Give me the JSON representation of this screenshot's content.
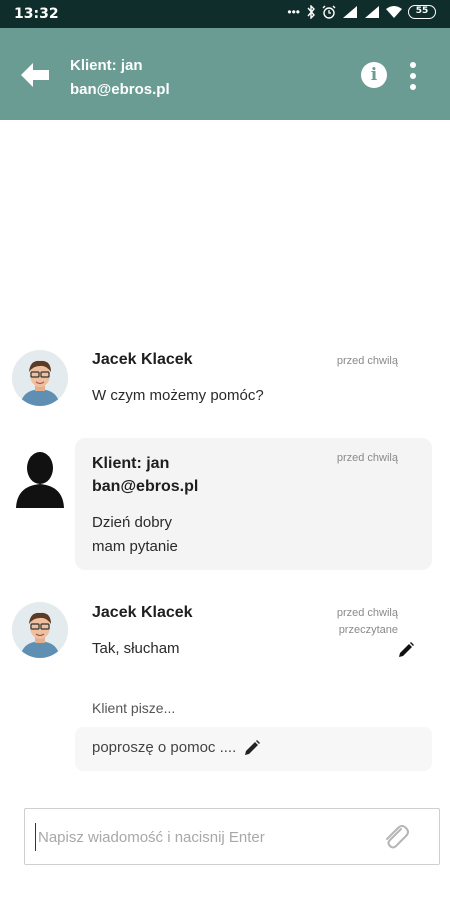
{
  "status_bar": {
    "time": "13:32",
    "battery": "55",
    "icons": [
      "dots-icon",
      "bluetooth-icon",
      "alarm-icon",
      "signal-icon",
      "signal-icon",
      "wifi-icon",
      "battery-icon"
    ]
  },
  "header": {
    "title_line1": "Klient: jan",
    "title_line2": "ban@ebros.pl",
    "bg_color": "#6a9c94"
  },
  "messages": [
    {
      "sender": "Jacek Klacek",
      "time": "przed chwilą",
      "lines": [
        "W czym możemy pomóc?"
      ],
      "avatar": "agent-avatar"
    },
    {
      "sender": "Klient: jan",
      "sender_line2": "ban@ebros.pl",
      "time": "przed chwilą",
      "lines": [
        "Dzień dobry",
        "mam pytanie"
      ],
      "avatar": "user-silhouette-icon"
    },
    {
      "sender": "Jacek Klacek",
      "time": "przed chwilą",
      "status": "przeczytane",
      "lines": [
        "Tak, słucham"
      ],
      "avatar": "agent-avatar"
    }
  ],
  "typing": {
    "label": "Klient pisze...",
    "draft": "poproszę o pomoc ...."
  },
  "composer": {
    "placeholder": "Napisz wiadomość i nacisnij Enter"
  }
}
